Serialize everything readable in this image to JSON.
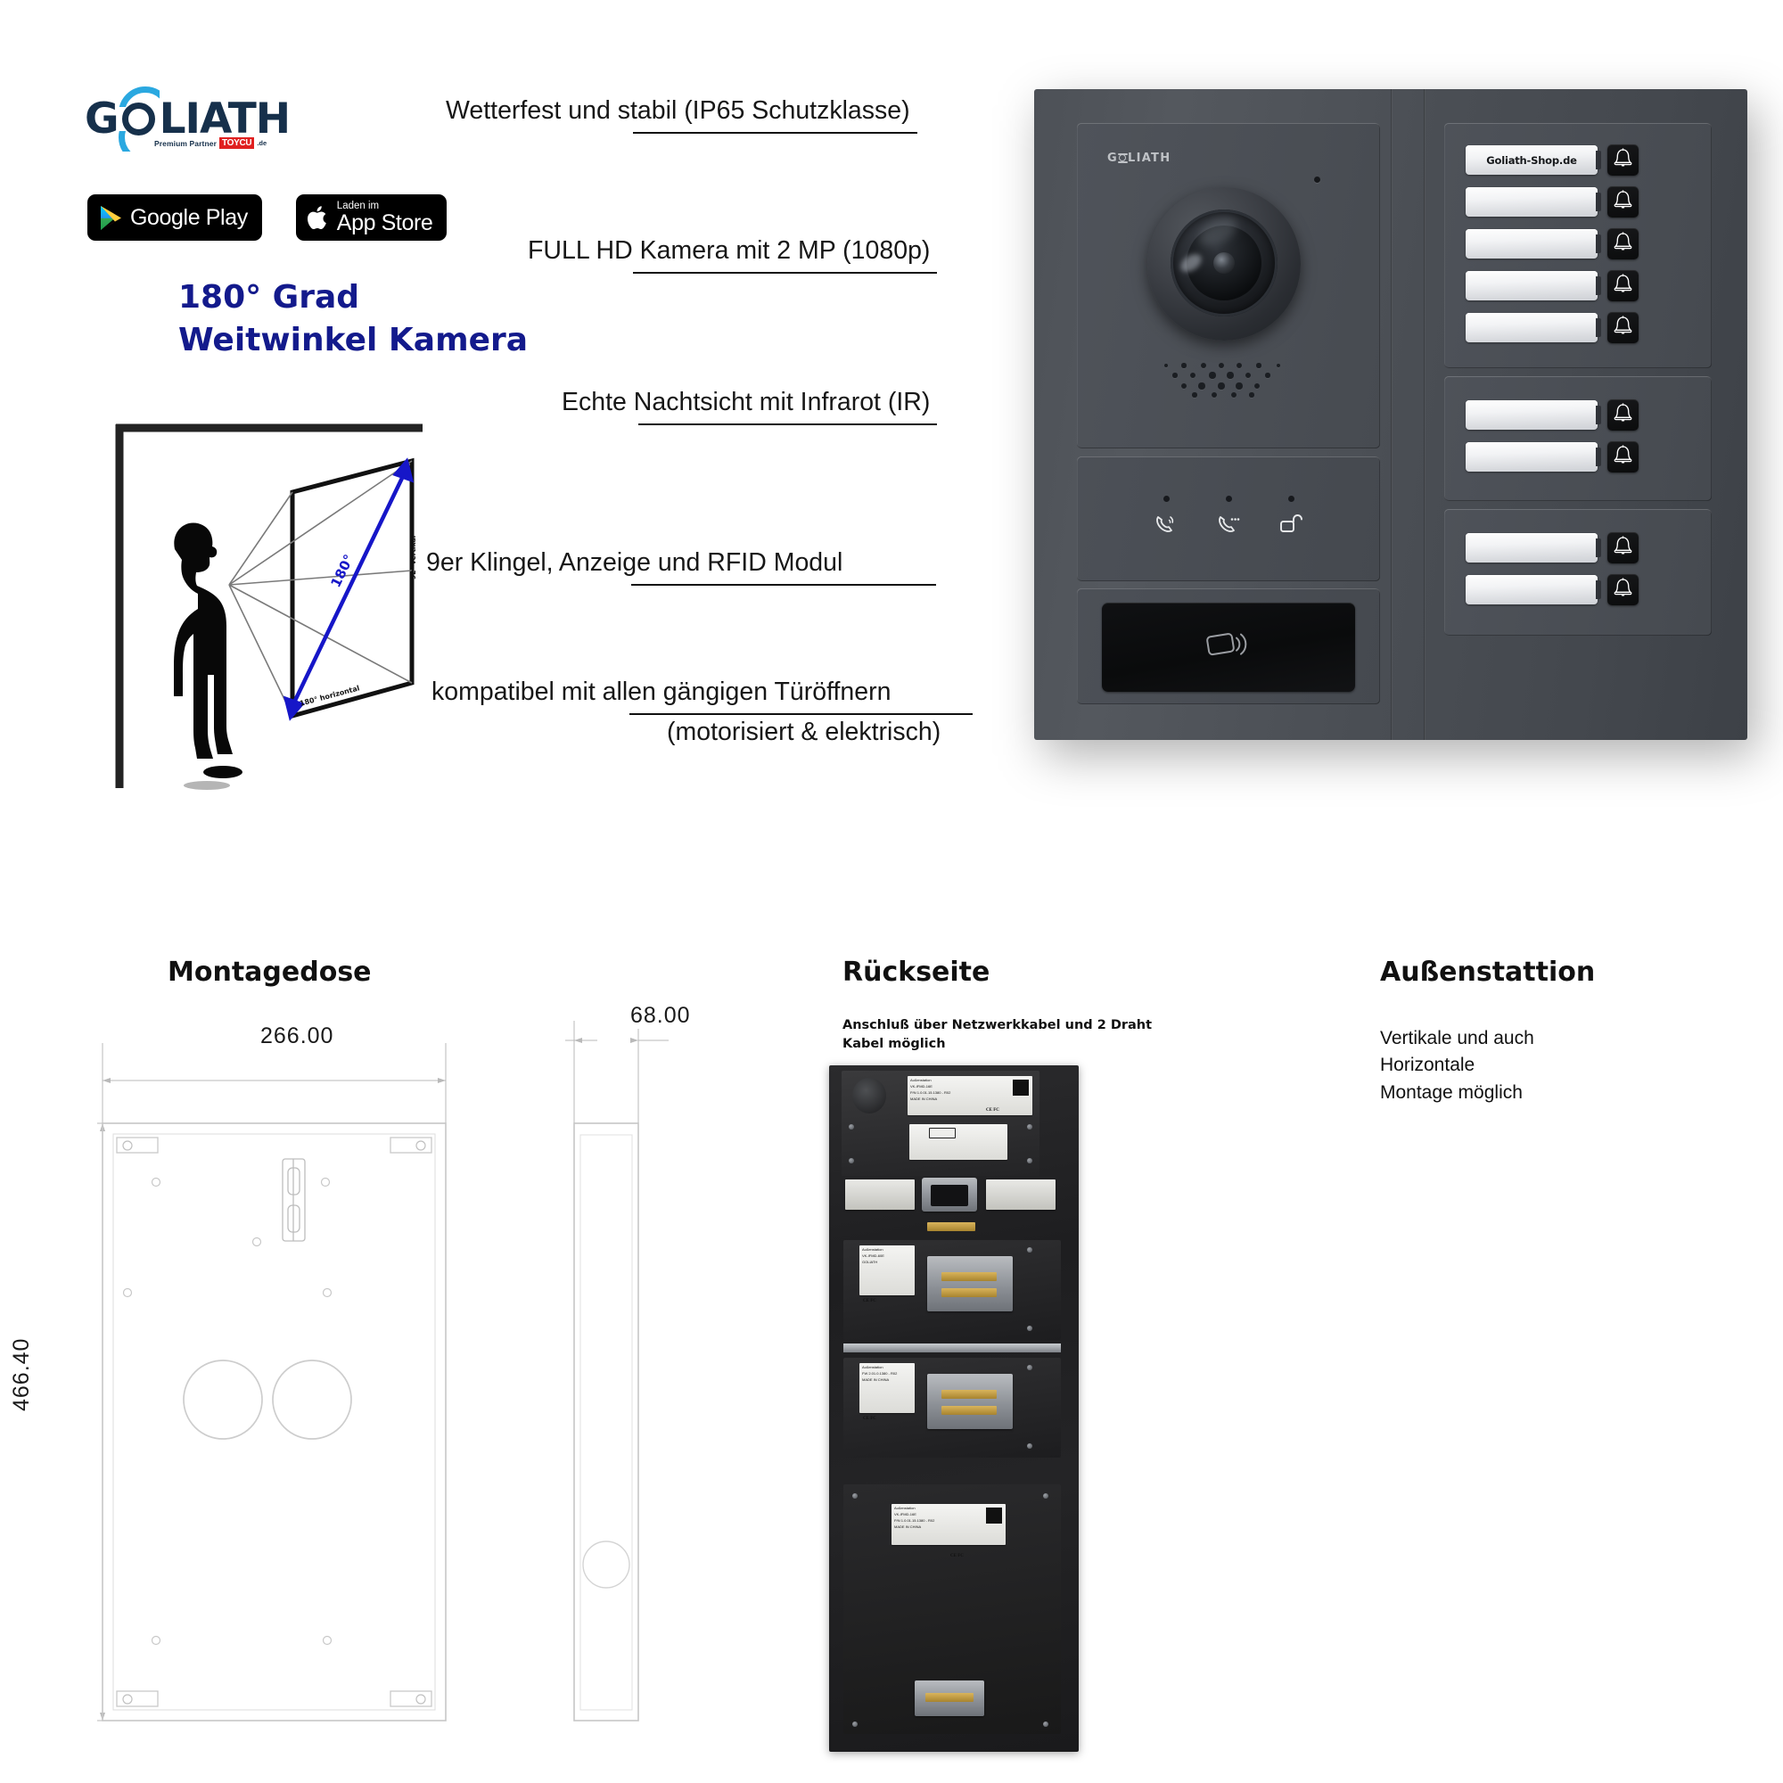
{
  "brand": {
    "logo_text_1": "G",
    "logo_text_2": "LIATH",
    "premium_partner": "Premium Partner",
    "partner_badge": "TOYCU",
    "partner_tld": ".de"
  },
  "badges": {
    "google": {
      "top": "",
      "big": "Google Play",
      "icon": "google-play-icon"
    },
    "apple": {
      "top": "Laden im",
      "big": "App Store",
      "icon": "apple-icon"
    }
  },
  "headline": {
    "line1": "180° Grad",
    "line2": "Weitwinkel Kamera",
    "color": "#131a8c"
  },
  "fov": {
    "angle_label": "180°",
    "horizontal_label": "180° horizontal",
    "vertical_label": "92° vertikal"
  },
  "features": [
    "Wetterfest und stabil (IP65 Schutzklasse)",
    "FULL HD Kamera mit 2 MP (1080p)",
    "Echte Nachtsicht mit Infrarot (IR)",
    "9er Klingel, Anzeige und RFID Modul",
    "kompatibel mit allen gängigen Türöffnern",
    "(motorisiert & elektrisch)"
  ],
  "product": {
    "camera_module": {
      "brand_mark": "GOLIATH",
      "lens": "fisheye-camera-lens",
      "mic": "microphone-hole",
      "speaker": "speaker-grille"
    },
    "status_buttons": [
      {
        "name": "call-button",
        "icon": "phone-call-icon"
      },
      {
        "name": "intercom-button",
        "icon": "phone-dots-icon"
      },
      {
        "name": "door-open-button",
        "icon": "unlock-icon"
      }
    ],
    "rfid": {
      "label": "rfid-reader",
      "icon": "rfid-card-icon"
    },
    "bell_panels": [
      {
        "plates": [
          "Goliath-Shop.de",
          "",
          "",
          "",
          ""
        ]
      },
      {
        "plates": [
          "",
          ""
        ]
      },
      {
        "plates": [
          "",
          ""
        ]
      }
    ],
    "bell_icon": "bell-icon"
  },
  "bottom": {
    "montagedose": {
      "title": "Montagedose",
      "width": "266.00",
      "height": "466.40",
      "depth": "68.00"
    },
    "rueckseite": {
      "title": "Rückseite",
      "note_line1": "Anschluß über Netzwerkkabel und 2 Draht",
      "note_line2": "Kabel möglich",
      "labels": {
        "l1_title": "Außenstation",
        "l1_line2": "VK-IFMD-16E",
        "l1_line3": "P/N 1.0.01.15.1380 - R02",
        "l1_line4": "MADE IN CHINA",
        "l2_title": "Außenstation",
        "l2_line2": "VK-IFMD-60E",
        "l2_line3": "FW 2.01.0.1380 - R02",
        "l2_line4": "GOLIATH",
        "l2_line5": "MADE IN CHINA",
        "ce": "CE FC"
      }
    },
    "aussenstattion": {
      "title": "Außenstattion",
      "note_line1": "Vertikale und auch",
      "note_line2": "Horizontale",
      "note_line3": "Montage möglich"
    }
  }
}
